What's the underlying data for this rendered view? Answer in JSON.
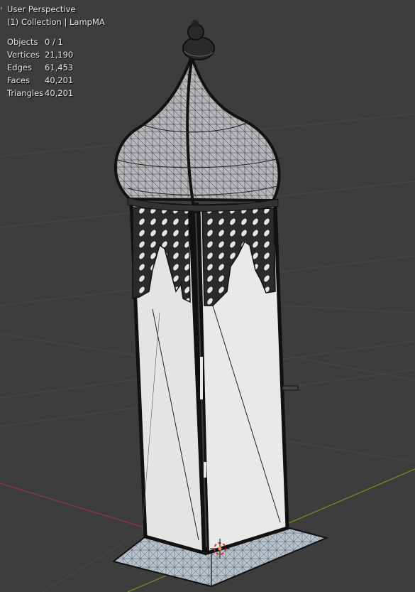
{
  "viewport": {
    "perspective_label": "User Perspective",
    "collection_label": "(1) Collection | LampMA",
    "stats": [
      {
        "label": "Objects",
        "value": "0 / 1"
      },
      {
        "label": "Vertices",
        "value": "21,190"
      },
      {
        "label": "Edges",
        "value": "61,453"
      },
      {
        "label": "Faces",
        "value": "40,201"
      },
      {
        "label": "Triangles",
        "value": "40,201"
      }
    ],
    "colors": {
      "background": "#3d3d3d",
      "grid_line": "#474747",
      "x_axis": "#8a3a44",
      "y_axis": "#6b8a2a",
      "wire": "#111111",
      "panel_light": "#e4e4e2",
      "panel_shade": "#c8c8c6",
      "dome": "#b7b8bb",
      "base": "#b8c2cc"
    }
  }
}
